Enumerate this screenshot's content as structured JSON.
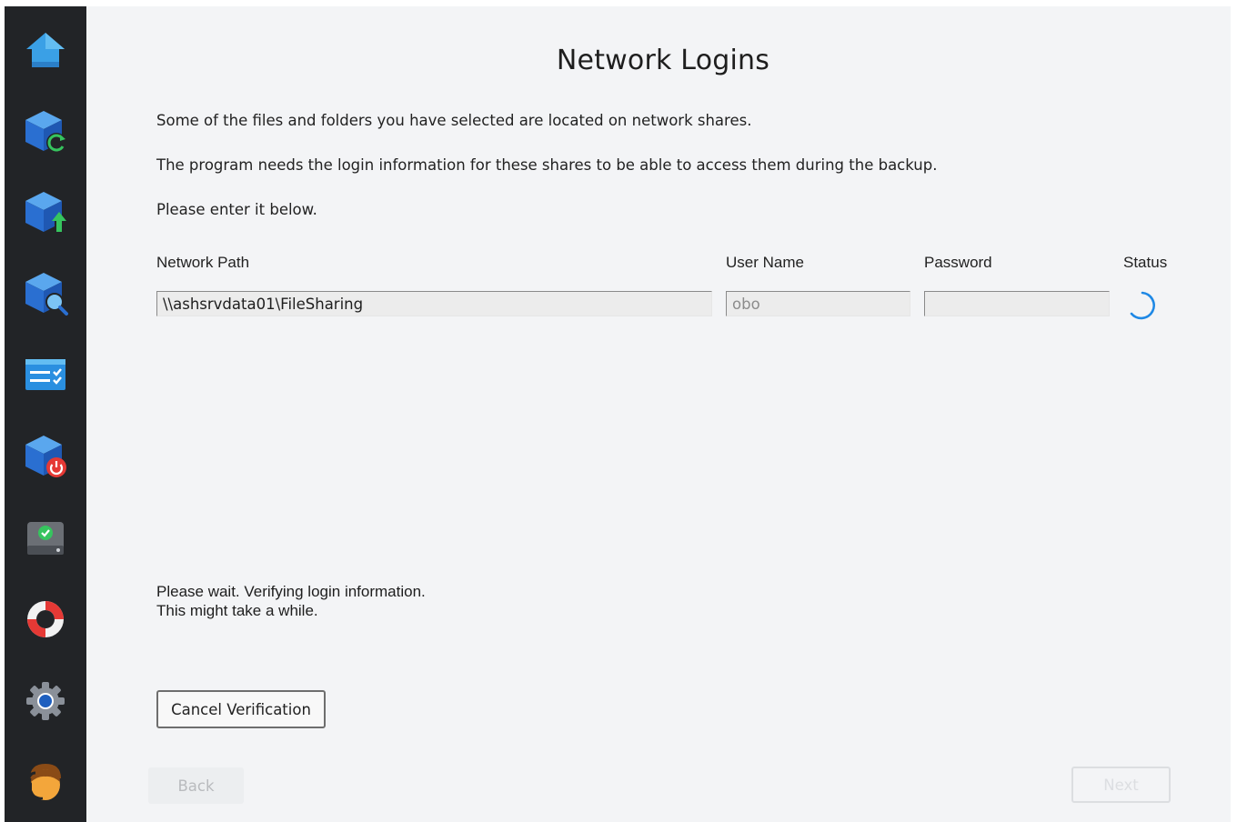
{
  "sidebar": {
    "items": [
      {
        "icon": "home-icon"
      },
      {
        "icon": "backup-restore-icon"
      },
      {
        "icon": "backup-upload-icon"
      },
      {
        "icon": "backup-search-icon"
      },
      {
        "icon": "task-list-icon"
      },
      {
        "icon": "backup-power-icon"
      },
      {
        "icon": "drive-check-icon"
      },
      {
        "icon": "lifebuoy-icon"
      },
      {
        "icon": "gear-icon"
      },
      {
        "icon": "user-avatar-icon"
      }
    ]
  },
  "page": {
    "title": "Network Logins",
    "intro_line1": "Some of the files and folders you have selected are located on network shares.",
    "intro_line2": "The program needs the login information for these shares to be able to access them during the backup.",
    "intro_line3": "Please enter it below."
  },
  "table": {
    "headers": {
      "network_path": "Network Path",
      "user_name": "User Name",
      "password": "Password",
      "status": "Status"
    },
    "row": {
      "network_path": "\\\\ashsrvdata01\\FileSharing",
      "user_name": "obo",
      "password": "",
      "status_icon": "loading-spinner-icon"
    }
  },
  "status": {
    "line1": "Please wait. Verifying login information.",
    "line2": "This might take a while."
  },
  "buttons": {
    "cancel_verification": "Cancel Verification",
    "back": "Back",
    "next": "Next"
  },
  "colors": {
    "sidebar_bg": "#222427",
    "main_bg": "#f3f4f6",
    "accent_blue": "#3b7fd9",
    "spinner": "#1e88e5"
  }
}
